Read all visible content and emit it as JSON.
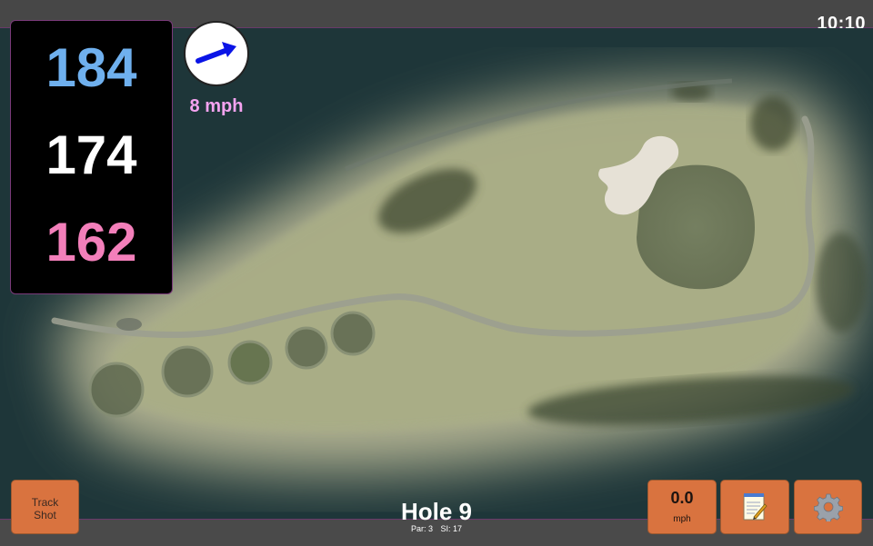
{
  "status": {
    "clock": "10:10"
  },
  "distances": {
    "back": "184",
    "middle": "174",
    "front": "162"
  },
  "wind": {
    "speed": "8 mph",
    "direction_icon": "wind-arrow-icon",
    "arrow_color": "#0a14e6"
  },
  "controls": {
    "track_shot_line1": "Track",
    "track_shot_line2": "Shot",
    "speed_value": "0.0",
    "speed_unit": "mph",
    "notes_icon": "notepad-icon",
    "settings_icon": "gear-icon"
  },
  "hole": {
    "title": "Hole 9",
    "par": "Par: 3",
    "si": "SI: 17"
  },
  "colors": {
    "back_distance": "#6fb0ee",
    "middle_distance": "#ffffff",
    "front_distance": "#f37fba",
    "wind_text": "#f5a3f0",
    "button": "#d9733f"
  }
}
